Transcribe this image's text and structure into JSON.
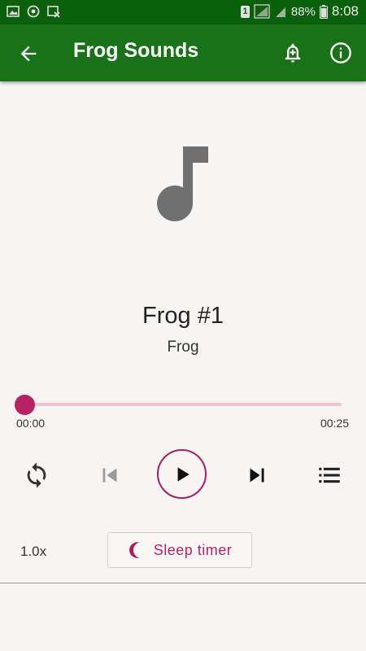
{
  "status_bar": {
    "battery": "88%",
    "time": "8:08",
    "sim_badge": "1",
    "icons": [
      "image-icon",
      "target-icon",
      "image-x-icon",
      "sim-icon",
      "signal-icon",
      "battery-icon"
    ]
  },
  "appbar": {
    "title": "Frog Sounds",
    "icons": [
      "back-arrow-icon",
      "add-alarm-icon",
      "info-icon"
    ]
  },
  "track": {
    "title": "Frog #1",
    "artist": "Frog",
    "icon": "music-note-icon"
  },
  "playback": {
    "current_time": "00:00",
    "duration": "00:25",
    "progress": 0.0
  },
  "controls": {
    "icons": [
      "repeat-icon",
      "skip-previous-icon",
      "play-icon",
      "skip-next-icon",
      "playlist-icon"
    ],
    "speed": "1.0x",
    "sleep_timer_label": "Sleep timer"
  },
  "colors": {
    "appbar": "#197217",
    "statusbar": "#0c5f0c",
    "accent": "#b62266",
    "progress_track": "#ecc3d6",
    "note_icon": "#707070"
  }
}
